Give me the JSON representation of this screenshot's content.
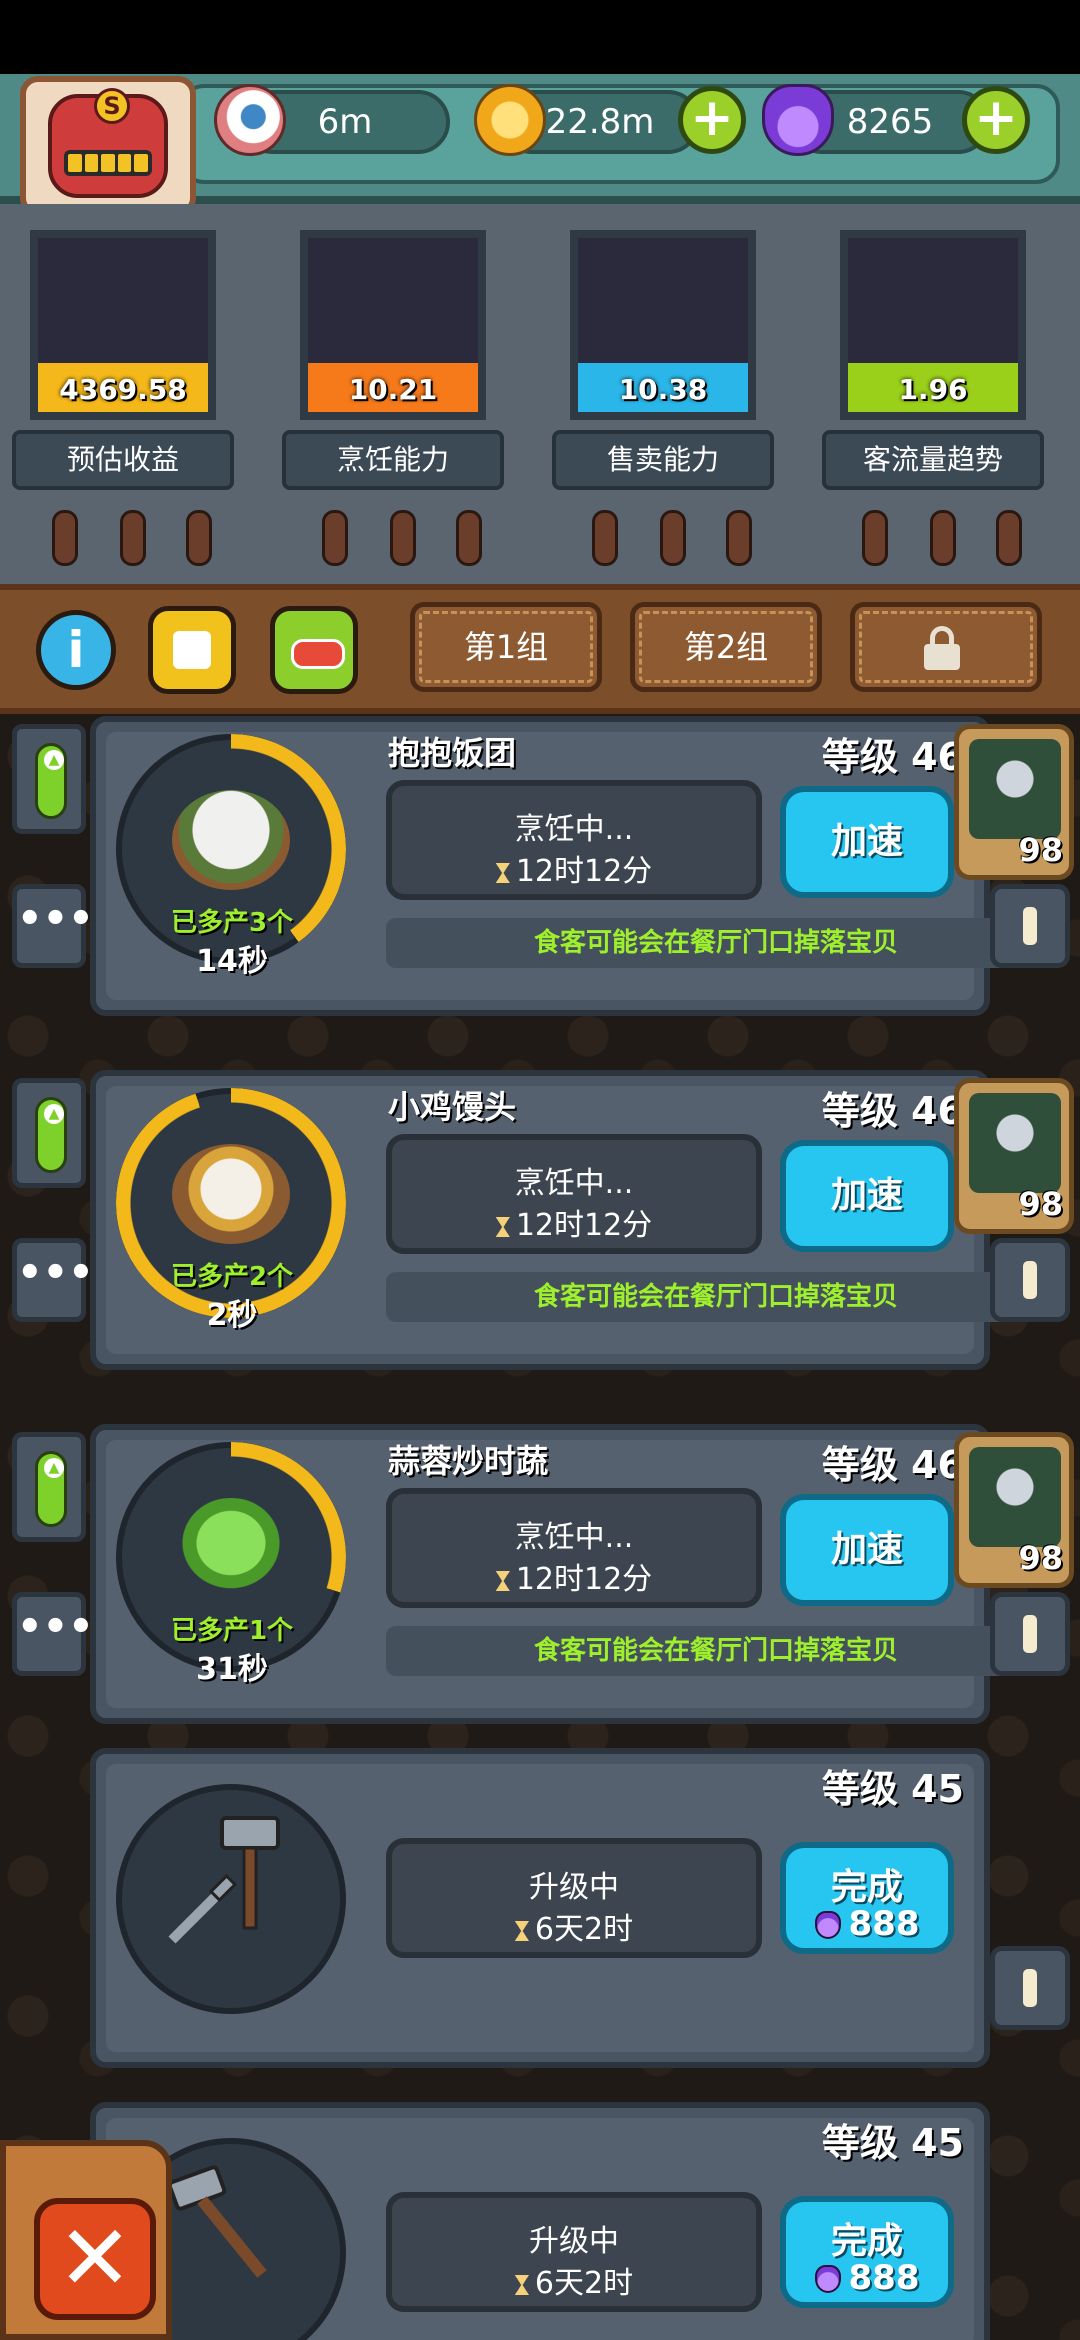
{
  "header": {
    "eyes": "6m",
    "coins": "22.8m",
    "potions": "8265",
    "avatar_letter": "S"
  },
  "stats": [
    {
      "value": "4369.58",
      "label": "预估收益",
      "color": "#f5b81a",
      "fill_fraction": 0.28
    },
    {
      "value": "10.21",
      "label": "烹饪能力",
      "color": "#f77a1a",
      "fill_fraction": 0.28
    },
    {
      "value": "10.38",
      "label": "售卖能力",
      "color": "#2ab6e8",
      "fill_fraction": 0.28
    },
    {
      "value": "1.96",
      "label": "客流量趋势",
      "color": "#9ad01a",
      "fill_fraction": 0.28
    }
  ],
  "toolbar": {
    "groups": [
      "第1组",
      "第2组"
    ]
  },
  "items": [
    {
      "name": "抱抱饭团",
      "level": "等级 46",
      "status": "烹饪中...",
      "time": "12时12分",
      "action": "加速",
      "extra": "已多产3个",
      "timer": "14秒",
      "tip": "食客可能会在餐厅门口掉落宝贝",
      "pet_count": "98",
      "progress": 0.4
    },
    {
      "name": "小鸡馒头",
      "level": "等级 46",
      "status": "烹饪中...",
      "time": "12时12分",
      "action": "加速",
      "extra": "已多产2个",
      "timer": "2秒",
      "tip": "食客可能会在餐厅门口掉落宝贝",
      "pet_count": "98",
      "progress": 0.95
    },
    {
      "name": "蒜蓉炒时蔬",
      "level": "等级 46",
      "status": "烹饪中...",
      "time": "12时12分",
      "action": "加速",
      "extra": "已多产1个",
      "timer": "31秒",
      "tip": "食客可能会在餐厅门口掉落宝贝",
      "pet_count": "98",
      "progress": 0.3
    },
    {
      "level": "等级 45",
      "status": "升级中",
      "time": "6天2时",
      "action_top": "完成",
      "action_cost": "888"
    },
    {
      "level": "等级 45",
      "status": "升级中",
      "time": "6天2时",
      "action_top": "完成",
      "action_cost": "888"
    }
  ]
}
